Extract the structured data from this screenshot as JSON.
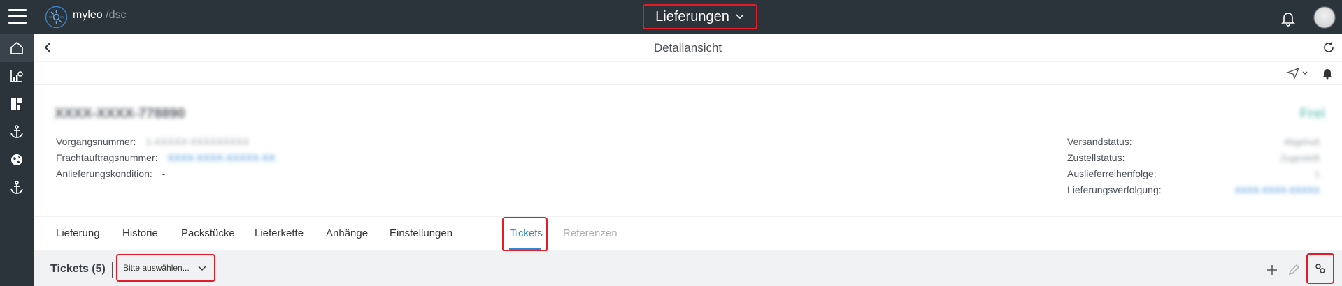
{
  "app": {
    "brand_main": "myleo",
    "brand_slash": "/",
    "brand_sub": "dsc",
    "module_title": "Lieferungen"
  },
  "detail": {
    "page_title": "Detailansicht"
  },
  "card": {
    "title_blurred": "XXXX-XXXX-778890",
    "status_blurred": "Frei",
    "left_fields": [
      {
        "label": "Vorgangsnummer:",
        "value": "1-XXXXX-XXXXXXXXX"
      },
      {
        "label": "Frachtauftragsnummer:",
        "value": "XXXX-XXXX-XXXXX-XX"
      },
      {
        "label": "Anlieferungskondition:",
        "value": "-"
      }
    ],
    "right_fields": [
      {
        "label": "Versandstatus:",
        "value": "Abgeholt"
      },
      {
        "label": "Zustellstatus:",
        "value": "Zugestellt"
      },
      {
        "label": "Auslieferreihenfolge:",
        "value": "1"
      },
      {
        "label": "Lieferungsverfolgung:",
        "value": "XXXX-XXXX-XXXXX"
      }
    ]
  },
  "tabs": [
    {
      "label": "Lieferung",
      "state": "normal"
    },
    {
      "label": "Historie",
      "state": "normal"
    },
    {
      "label": "Packstücke",
      "state": "normal"
    },
    {
      "label": "Lieferkette",
      "state": "normal"
    },
    {
      "label": "Anhänge",
      "state": "normal"
    },
    {
      "label": "Einstellungen",
      "state": "normal"
    },
    {
      "label": "Tickets",
      "state": "active"
    },
    {
      "label": "Referenzen",
      "state": "disabled"
    }
  ],
  "tickets": {
    "title": "Tickets (5)",
    "select_placeholder": "Bitte auswählen..."
  },
  "nav_icons": [
    "home-icon",
    "chart-icon",
    "dashboard-icon",
    "anchor-icon",
    "globe-icon",
    "anchor-icon"
  ],
  "colors": {
    "topbar": "#2b333b",
    "accent": "#2f86d6",
    "highlight": "#e11d2a"
  }
}
